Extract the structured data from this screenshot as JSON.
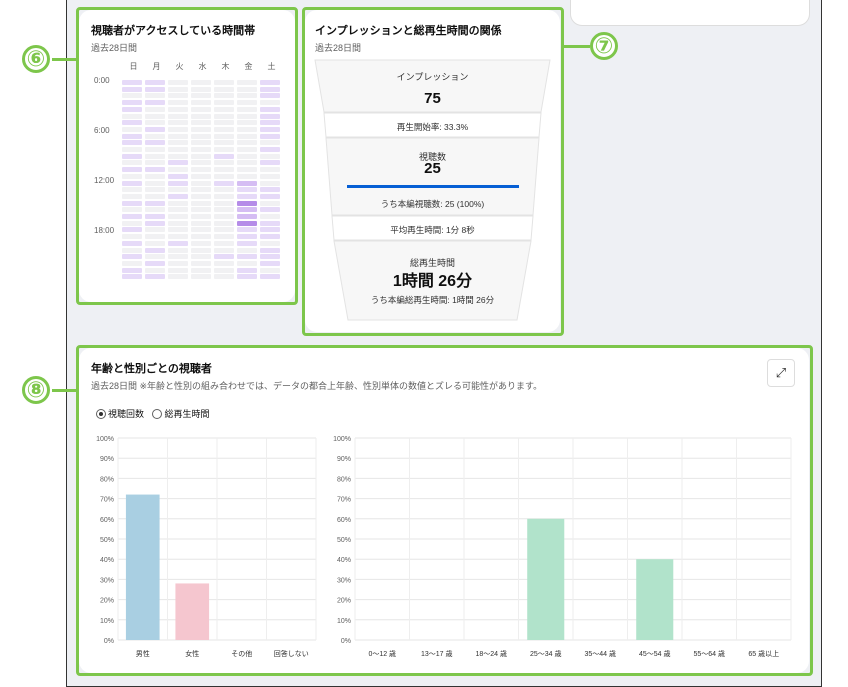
{
  "markers": {
    "m6": "⑥",
    "m7": "⑦",
    "m8": "⑧"
  },
  "heatmap": {
    "title": "視聴者がアクセスしている時間帯",
    "subtitle": "過去28日間",
    "days": [
      "日",
      "月",
      "火",
      "水",
      "木",
      "金",
      "土"
    ],
    "times": [
      "0:00",
      "6:00",
      "12:00",
      "18:00"
    ],
    "levels": [
      [
        1,
        1,
        0,
        0,
        0,
        0,
        1
      ],
      [
        1,
        1,
        0,
        0,
        0,
        0,
        1
      ],
      [
        0,
        0,
        0,
        0,
        0,
        0,
        1
      ],
      [
        1,
        1,
        0,
        0,
        0,
        0,
        0
      ],
      [
        1,
        0,
        0,
        0,
        0,
        0,
        1
      ],
      [
        0,
        0,
        0,
        0,
        0,
        0,
        1
      ],
      [
        1,
        0,
        0,
        0,
        0,
        0,
        1
      ],
      [
        0,
        1,
        0,
        0,
        0,
        0,
        1
      ],
      [
        1,
        0,
        0,
        0,
        0,
        0,
        1
      ],
      [
        1,
        1,
        0,
        0,
        0,
        0,
        0
      ],
      [
        0,
        0,
        0,
        0,
        0,
        0,
        1
      ],
      [
        1,
        0,
        0,
        0,
        1,
        0,
        0
      ],
      [
        0,
        0,
        1,
        0,
        0,
        0,
        1
      ],
      [
        1,
        1,
        0,
        0,
        0,
        0,
        0
      ],
      [
        0,
        0,
        1,
        0,
        0,
        0,
        0
      ],
      [
        1,
        0,
        1,
        0,
        1,
        2,
        0
      ],
      [
        0,
        0,
        0,
        0,
        0,
        1,
        1
      ],
      [
        0,
        0,
        1,
        0,
        0,
        1,
        1
      ],
      [
        1,
        1,
        0,
        0,
        0,
        3,
        0
      ],
      [
        0,
        0,
        0,
        0,
        0,
        2,
        1
      ],
      [
        1,
        1,
        0,
        0,
        0,
        2,
        0
      ],
      [
        0,
        1,
        0,
        0,
        0,
        3,
        1
      ],
      [
        1,
        0,
        0,
        0,
        0,
        1,
        1
      ],
      [
        0,
        0,
        0,
        0,
        0,
        1,
        1
      ],
      [
        1,
        0,
        1,
        0,
        0,
        1,
        0
      ],
      [
        0,
        1,
        0,
        0,
        0,
        0,
        1
      ],
      [
        1,
        0,
        0,
        0,
        1,
        1,
        1
      ],
      [
        0,
        1,
        0,
        0,
        0,
        0,
        1
      ],
      [
        1,
        0,
        0,
        0,
        0,
        1,
        0
      ],
      [
        1,
        1,
        0,
        0,
        0,
        1,
        1
      ]
    ],
    "colors": [
      "#f1f1f3",
      "#e6daf8",
      "#d5bdf3",
      "#b58ce8"
    ]
  },
  "funnel": {
    "title": "インプレッションと総再生時間の関係",
    "subtitle": "過去28日間",
    "impressions_label": "インプレッション",
    "impressions_value": "75",
    "ctr_label": "再生開始率: 33.3%",
    "views_label": "視聴数",
    "views_value": "25",
    "views_progress": 1.0,
    "views_sub": "うち本編視聴数: 25 (100%)",
    "avg_label": "平均再生時間: 1分 8秒",
    "watch_label": "総再生時間",
    "watch_value": "1時間 26分",
    "watch_sub": "うち本編総再生時間: 1時間 26分",
    "progress_color": "#065fd4"
  },
  "age_gender": {
    "title": "年齢と性別ごとの視聴者",
    "subtitle": "過去28日間 ※年齢と性別の組み合わせでは、データの都合上年齢、性別単体の数値とズレる可能性があります。",
    "radio_views": "視聴回数",
    "radio_watch": "総再生時間",
    "expand_icon": "⤢"
  },
  "chart_data": [
    {
      "type": "bar",
      "categories": [
        "男性",
        "女性",
        "その他",
        "回答しない"
      ],
      "values": [
        72,
        28,
        0,
        0
      ],
      "colors": [
        "#a9cfe2",
        "#f5c6cf",
        "#a9cfe2",
        "#a9cfe2"
      ],
      "ylim": [
        0,
        100
      ],
      "yticks": [
        "0%",
        "10%",
        "20%",
        "30%",
        "40%",
        "50%",
        "60%",
        "70%",
        "80%",
        "90%",
        "100%"
      ],
      "grid": true
    },
    {
      "type": "bar",
      "categories": [
        "0〜12 歳",
        "13〜17 歳",
        "18〜24 歳",
        "25〜34 歳",
        "35〜44 歳",
        "45〜54 歳",
        "55〜64 歳",
        "65 歳以上"
      ],
      "values": [
        0,
        0,
        0,
        60,
        0,
        40,
        0,
        0
      ],
      "colors": [
        "#b1e3cb",
        "#b1e3cb",
        "#b1e3cb",
        "#b1e3cb",
        "#b1e3cb",
        "#b1e3cb",
        "#b1e3cb",
        "#b1e3cb"
      ],
      "ylim": [
        0,
        100
      ],
      "yticks": [
        "0%",
        "10%",
        "20%",
        "30%",
        "40%",
        "50%",
        "60%",
        "70%",
        "80%",
        "90%",
        "100%"
      ],
      "grid": true
    }
  ]
}
